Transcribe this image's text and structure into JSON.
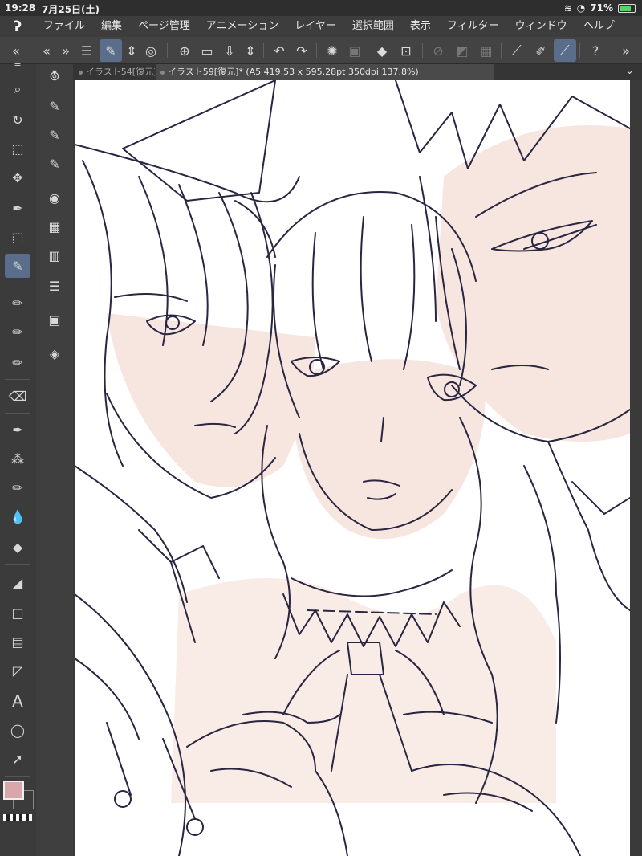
{
  "status": {
    "time": "19:28",
    "date": "7月25日(土)",
    "battery": "71%"
  },
  "app": {
    "logo": "ʔ"
  },
  "menu": [
    "ファイル",
    "編集",
    "ページ管理",
    "アニメーション",
    "レイヤー",
    "選択範囲",
    "表示",
    "フィルター",
    "ウィンドウ",
    "ヘルプ"
  ],
  "tabs": [
    {
      "label": "イラスト54[復元]"
    },
    {
      "label": "イラスト59[復元]* (A5 419.53 x 595.28pt 350dpi 137.8%)"
    }
  ],
  "colors": {
    "accent": "#5a6e8c",
    "main_color": "#d8a7ab",
    "skin": "#f7e6e0"
  }
}
